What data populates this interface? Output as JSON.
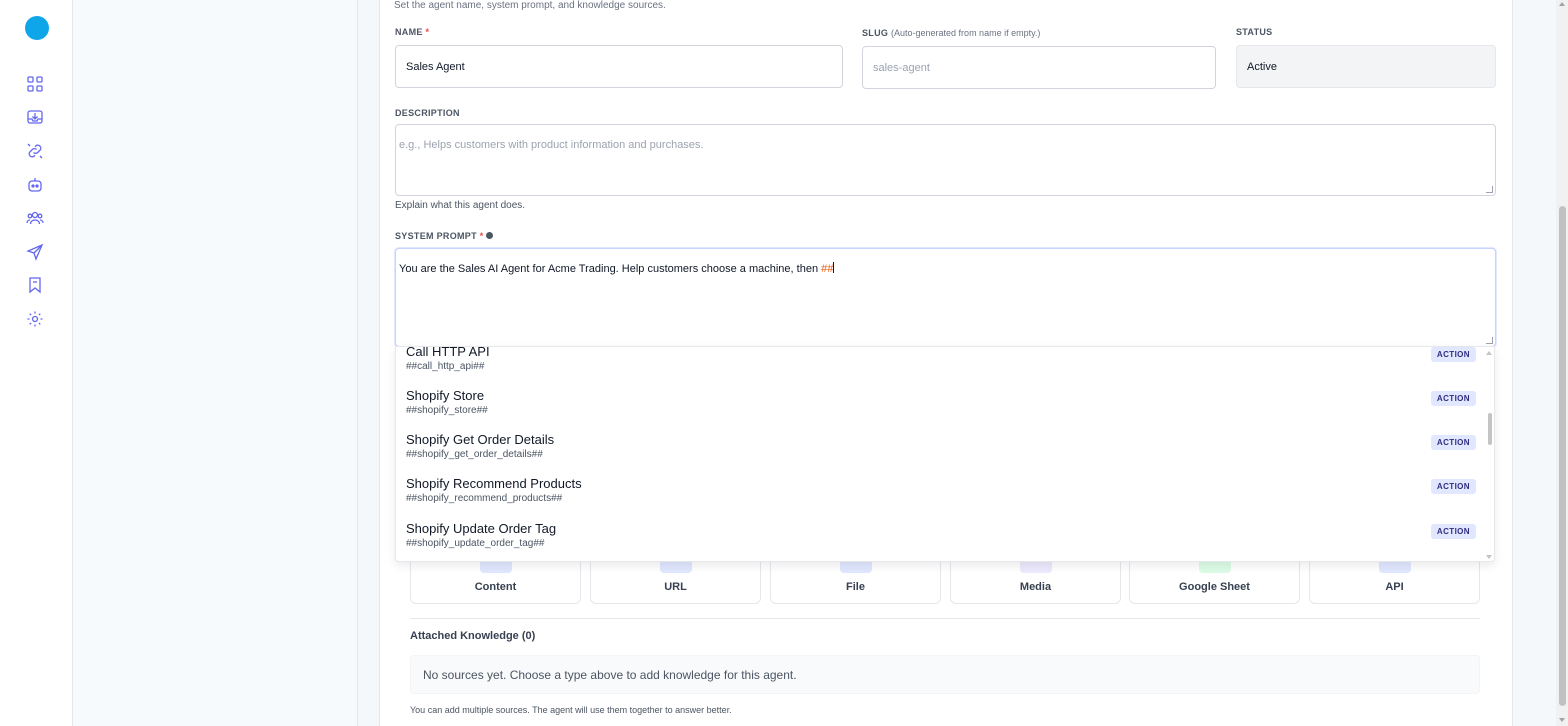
{
  "sidebar": {
    "items": [
      {
        "icon": "dashboard-grid-icon"
      },
      {
        "icon": "inbox-download-icon"
      },
      {
        "icon": "integrations-link-icon"
      },
      {
        "icon": "bot-icon"
      },
      {
        "icon": "users-icon"
      },
      {
        "icon": "send-icon"
      },
      {
        "icon": "bookmark-icon"
      },
      {
        "icon": "settings-gear-icon"
      }
    ],
    "accent": "#6366f1",
    "logo_color": "#0ea5e9"
  },
  "form": {
    "subtitle": "Set the agent name, system prompt, and knowledge sources.",
    "name": {
      "label": "NAME",
      "required": "*",
      "value": "Sales Agent"
    },
    "slug": {
      "label": "SLUG",
      "hint": "(Auto-generated from name if empty.)",
      "placeholder": "sales-agent"
    },
    "status": {
      "label": "STATUS",
      "value": "Active"
    },
    "description": {
      "label": "DESCRIPTION",
      "placeholder": "e.g., Helps customers with product information and purchases.",
      "helper": "Explain what this agent does."
    },
    "system_prompt": {
      "label": "SYSTEM PROMPT",
      "required": "*",
      "value": "You are the Sales AI Agent for Acme Trading. Help customers choose a machine, then ",
      "typed_token": "##"
    }
  },
  "dropdown": {
    "items": [
      {
        "name": "Call HTTP API",
        "tag": "##call_http_api##",
        "badge": "ACTION"
      },
      {
        "name": "Shopify Store",
        "tag": "##shopify_store##",
        "badge": "ACTION"
      },
      {
        "name": "Shopify Get Order Details",
        "tag": "##shopify_get_order_details##",
        "badge": "ACTION"
      },
      {
        "name": "Shopify Recommend Products",
        "tag": "##shopify_recommend_products##",
        "badge": "ACTION"
      },
      {
        "name": "Shopify Update Order Tag",
        "tag": "##shopify_update_order_tag##",
        "badge": "ACTION"
      }
    ]
  },
  "knowledge": {
    "sources": [
      {
        "label": "Content"
      },
      {
        "label": "URL"
      },
      {
        "label": "File"
      },
      {
        "label": "Media"
      },
      {
        "label": "Google Sheet"
      },
      {
        "label": "API"
      }
    ],
    "attached_title": "Attached Knowledge (0)",
    "empty_text": "No sources yet. Choose a type above to add knowledge for this agent.",
    "footnote": "You can add multiple sources. The agent will use them together to answer better."
  }
}
